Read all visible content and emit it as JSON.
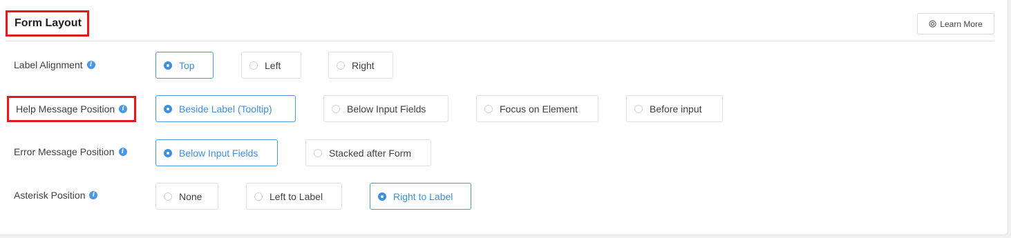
{
  "header": {
    "title": "Form Layout",
    "learn_more": "Learn More",
    "learn_more_icon": "lifebuoy-icon"
  },
  "rows": [
    {
      "label": "Label Alignment",
      "options": [
        {
          "label": "Top",
          "selected": true
        },
        {
          "label": "Left",
          "selected": false
        },
        {
          "label": "Right",
          "selected": false
        }
      ]
    },
    {
      "label": "Help Message Position",
      "options": [
        {
          "label": "Beside Label (Tooltip)",
          "selected": true
        },
        {
          "label": "Below Input Fields",
          "selected": false
        },
        {
          "label": "Focus on Element",
          "selected": false
        },
        {
          "label": "Before input",
          "selected": false
        }
      ]
    },
    {
      "label": "Error Message Position",
      "options": [
        {
          "label": "Below Input Fields",
          "selected": true
        },
        {
          "label": "Stacked after Form",
          "selected": false
        }
      ]
    },
    {
      "label": "Asterisk Position",
      "options": [
        {
          "label": "None",
          "selected": false
        },
        {
          "label": "Left to Label",
          "selected": false
        },
        {
          "label": "Right to Label",
          "selected": true
        }
      ]
    }
  ],
  "colors": {
    "accent": "#3d8fe3",
    "highlight_border": "#e5181e",
    "info_icon": "#4a97e8"
  }
}
